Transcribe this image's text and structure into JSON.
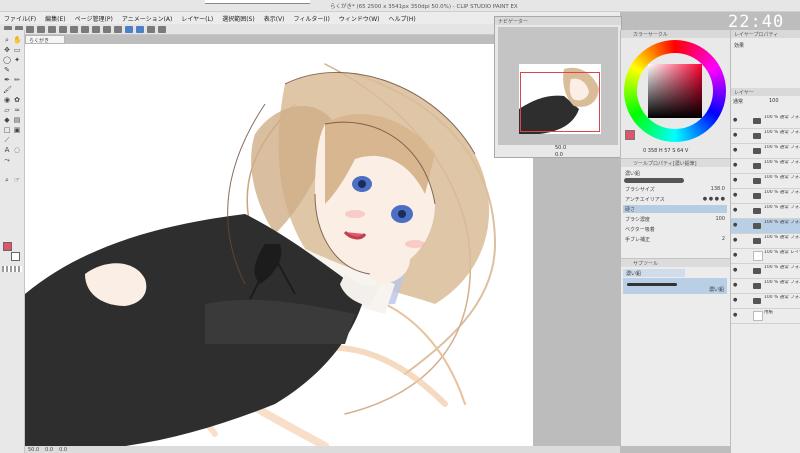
{
  "window": {
    "title": "らくがき* (65 2500 x 3541px 350dpi 50.0%) - CLIP STUDIO PAINT EX"
  },
  "clock": "22:40",
  "menu": [
    "ファイル(F)",
    "編集(E)",
    "ページ管理(P)",
    "アニメーション(A)",
    "レイヤー(L)",
    "選択範囲(S)",
    "表示(V)",
    "フィルター(I)",
    "ウィンドウ(W)",
    "ヘルプ(H)"
  ],
  "document_tab": "らくがき",
  "status": {
    "zoom": "50.0",
    "coords": "0.0",
    "pos": "0.0"
  },
  "navigator": {
    "title": "ナビゲーター",
    "zoom": "50.0",
    "rotation": "0.0"
  },
  "color_panel": {
    "title": "カラーサークル",
    "values": "0 358 H  57 S  64 V"
  },
  "tool_property": {
    "title": "ツールプロパティ[濃い鉛筆]",
    "tool_name": "濃い鉛",
    "rows": [
      {
        "label": "ブラシサイズ",
        "value": "138.0"
      },
      {
        "label": "アンチエイリアス",
        "value": ""
      },
      {
        "label": "硬さ",
        "value": ""
      },
      {
        "label": "ブラシ濃度",
        "value": "100"
      },
      {
        "label": "ベクター吸着",
        "value": ""
      },
      {
        "label": "手ブレ補正",
        "value": "2"
      }
    ]
  },
  "sub_tool": {
    "title": "サブツール",
    "item1": "濃い鉛",
    "item2": "濃い鉛"
  },
  "layer_panel": {
    "title": "レイヤープロパティ",
    "title2": "レイヤー",
    "effect": "効果",
    "blend": "通常",
    "opacity": "100",
    "layers": [
      {
        "name": "100 % 通常 フォルダー 5",
        "type": "folder",
        "visible": true,
        "selected": false
      },
      {
        "name": "100 % 通常 フォルダー 3",
        "type": "folder",
        "visible": true,
        "selected": false
      },
      {
        "name": "100 % 通常 フォルダー 2",
        "type": "folder",
        "visible": true,
        "selected": false
      },
      {
        "name": "100 % 通常 フォルダー 4",
        "type": "folder",
        "visible": true,
        "selected": false
      },
      {
        "name": "100 % 通常 フォルダー 12",
        "type": "folder",
        "visible": true,
        "selected": false
      },
      {
        "name": "100 % 通常 フォルダー 11",
        "type": "folder",
        "visible": true,
        "selected": false
      },
      {
        "name": "100 % 通常 フォルダー 16",
        "type": "folder",
        "visible": true,
        "selected": false
      },
      {
        "name": "100 % 通常 フォルダー 26",
        "type": "folder",
        "visible": true,
        "selected": true
      },
      {
        "name": "100 % 通常 フォルダー 25",
        "type": "folder",
        "visible": true,
        "selected": false
      },
      {
        "name": "100 % 通常 レイヤー 173",
        "type": "layer",
        "visible": true,
        "selected": false
      },
      {
        "name": "100 % 通常 フォルダー 15",
        "type": "folder",
        "visible": true,
        "selected": false
      },
      {
        "name": "100 % 通常 フォルダー 14",
        "type": "folder",
        "visible": true,
        "selected": false
      },
      {
        "name": "100 % 通常 フォルダー 1",
        "type": "folder",
        "visible": true,
        "selected": false
      },
      {
        "name": "用紙",
        "type": "paper",
        "visible": true,
        "selected": false
      }
    ]
  },
  "colors": {
    "main": "#e0556b",
    "sub": "#ffffff",
    "hair": "#d4b48c",
    "line": "#6b4a38",
    "dress": "#2e2e2e"
  }
}
